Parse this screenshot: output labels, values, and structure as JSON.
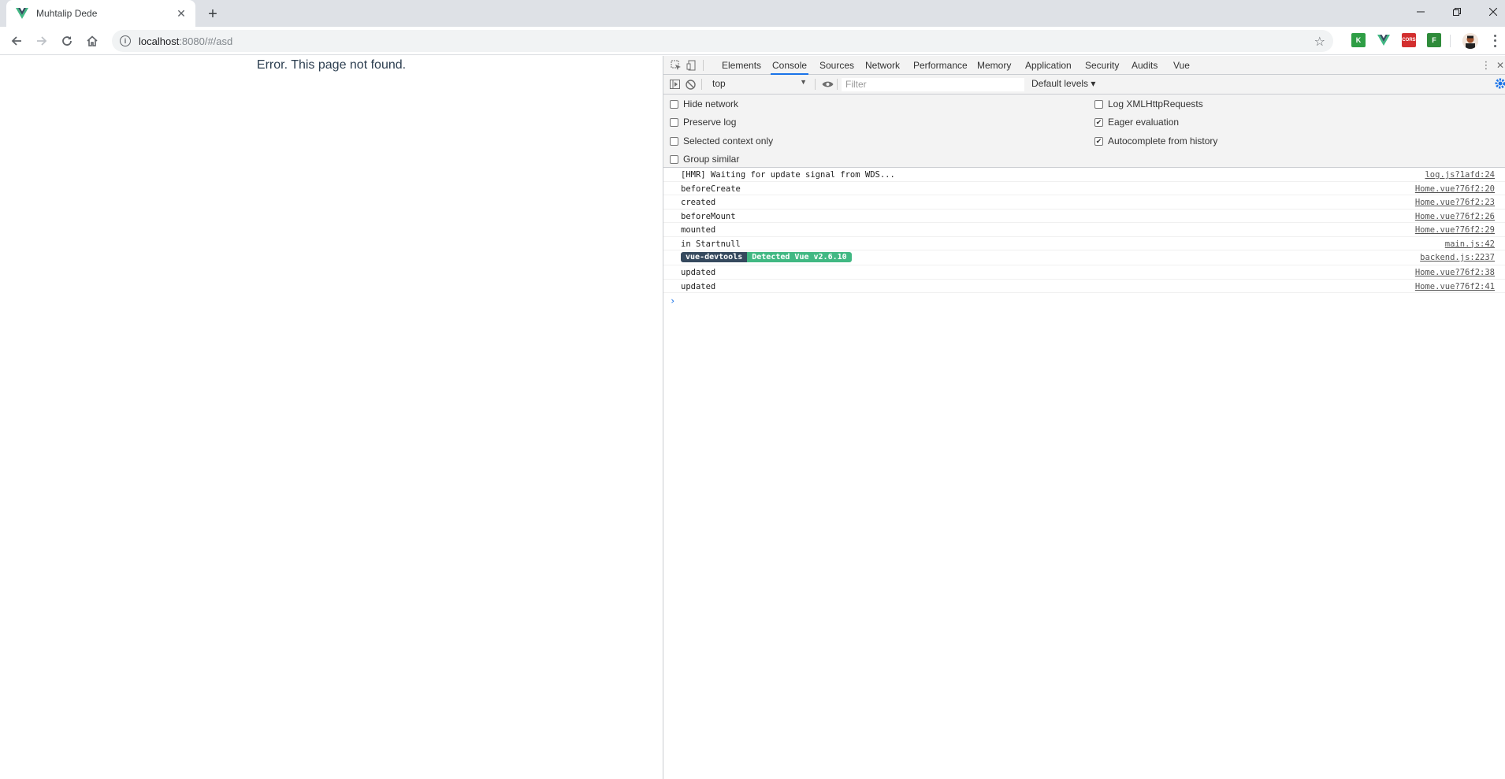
{
  "browser": {
    "tab_title": "Muhtalip Dede",
    "tab_favicon": "vue-logo-icon",
    "new_tab_label": "+",
    "close_label": "✕",
    "url_host": "localhost",
    "url_rest": ":8080/#/asd",
    "extensions": [
      {
        "name": "kanbanier-extension-icon",
        "color": "#2e9e45",
        "text": "K"
      },
      {
        "name": "vue-devtools-extension-icon",
        "color": "#ffffff",
        "text": ""
      },
      {
        "name": "cors-extension-icon",
        "color": "#d32f2f",
        "text": "CORS"
      },
      {
        "name": "green-extension-icon",
        "color": "#2e8b3a",
        "text": "F"
      }
    ]
  },
  "page": {
    "error_text": "Error. This page not found."
  },
  "devtools": {
    "tabs": [
      "Elements",
      "Console",
      "Sources",
      "Network",
      "Performance",
      "Memory",
      "Application",
      "Security",
      "Audits",
      "Vue"
    ],
    "active_tab": "Console",
    "context": "top",
    "filter_placeholder": "Filter",
    "levels": "Default levels ▾",
    "settings": {
      "left": [
        {
          "label": "Hide network",
          "checked": false
        },
        {
          "label": "Preserve log",
          "checked": false
        },
        {
          "label": "Selected context only",
          "checked": false
        },
        {
          "label": "Group similar",
          "checked": false
        }
      ],
      "right": [
        {
          "label": "Log XMLHttpRequests",
          "checked": false
        },
        {
          "label": "Eager evaluation",
          "checked": true
        },
        {
          "label": "Autocomplete from history",
          "checked": true
        }
      ]
    },
    "log": [
      {
        "msg": "[HMR] Waiting for update signal from WDS...",
        "src": "log.js?1afd:24"
      },
      {
        "msg": "beforeCreate",
        "src": "Home.vue?76f2:20"
      },
      {
        "msg": "created",
        "src": "Home.vue?76f2:23"
      },
      {
        "msg": "beforeMount",
        "src": "Home.vue?76f2:26"
      },
      {
        "msg": "mounted",
        "src": "Home.vue?76f2:29"
      },
      {
        "msg": "in Startnull",
        "src": "main.js:42"
      },
      {
        "badge_dark": "vue-devtools",
        "badge_green": "Detected Vue v2.6.10",
        "src": "backend.js:2237"
      },
      {
        "msg": "updated",
        "src": "Home.vue?76f2:38"
      },
      {
        "msg": "updated",
        "src": "Home.vue?76f2:41"
      }
    ],
    "prompt": "›"
  }
}
